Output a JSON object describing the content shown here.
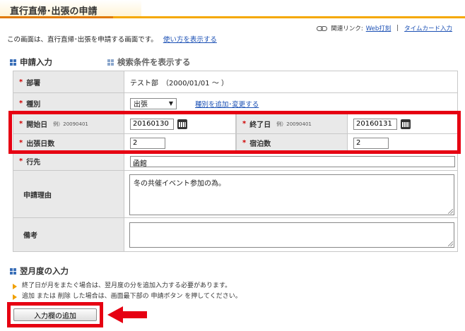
{
  "page": {
    "title": "直行直帰･出張の申請",
    "intro": "この画面は、直行直帰･出張を申請する画面です。",
    "howto_link": "使い方を表示する"
  },
  "related_links": {
    "label": "関連リンク:",
    "items": [
      "Web打刻",
      "タイムカード入力"
    ],
    "separator": "|"
  },
  "sections": {
    "apply_input": "申請入力",
    "show_search": "検索条件を表示する",
    "next_month": "翌月度の入力"
  },
  "form": {
    "dept": {
      "label": "部署",
      "value": "テスト部　（2000/01/01 ～ ）"
    },
    "type": {
      "label": "種別",
      "selected": "出張",
      "link": "種別を追加･変更する"
    },
    "start_date": {
      "label": "開始日",
      "example": "例）20090401",
      "value": "20160130"
    },
    "end_date": {
      "label": "終了日",
      "example": "例）20090401",
      "value": "20160131"
    },
    "trip_days": {
      "label": "出張日数",
      "value": "2"
    },
    "nights": {
      "label": "宿泊数",
      "value": "2"
    },
    "destination": {
      "label": "行先",
      "value": "函館"
    },
    "reason": {
      "label": "申請理由",
      "value": "冬の共催イベント参加の為。"
    },
    "remarks": {
      "label": "備考",
      "value": ""
    },
    "required_mark": "*"
  },
  "notes": [
    "終了日が月をまたぐ場合は、翌月度の分を追加入力する必要があります。",
    "追加 または 削除 した場合は、画面最下部の 申請ボタン を押してください。"
  ],
  "add_button": "入力欄の追加",
  "colors": {
    "accent_orange": "#f5a800",
    "highlight_red": "#e60012",
    "link_blue": "#1a4fb4",
    "label_bg": "#e9e9e9"
  }
}
